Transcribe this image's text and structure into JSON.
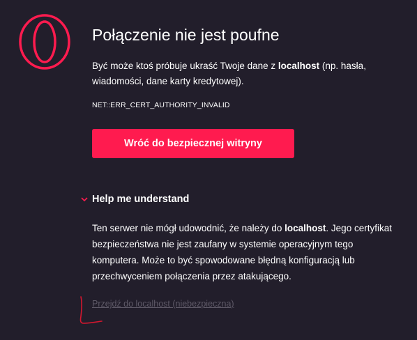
{
  "page": {
    "title": "Połączenie nie jest poufne",
    "description_prefix": "Być może ktoś próbuje ukraść Twoje dane z ",
    "host": "localhost",
    "description_suffix": " (np. hasła, wiadomości, dane karty kredytowej).",
    "error_code": "NET::ERR_CERT_AUTHORITY_INVALID",
    "back_button_label": "Wróć do bezpiecznej witryny",
    "help_title": "Help me understand",
    "details_prefix": "Ten serwer nie mógł udowodnić, że należy do ",
    "details_host": "localhost",
    "details_suffix": ". Jego certyfikat bezpieczeństwa nie jest zaufany w systemie operacyjnym tego komputera. Może to być spowodowane błędną konfiguracją lub przechwyceniem połączenia przez atakującego.",
    "proceed_link": "Przejdź do localhost (niebezpieczna)"
  },
  "icons": {
    "logo": "opera-logo-icon",
    "chevron": "chevron-down-icon"
  },
  "colors": {
    "background": "#221e2b",
    "accent": "#ff1b4f",
    "text": "#ffffff",
    "muted_link": "#5f5a68"
  }
}
